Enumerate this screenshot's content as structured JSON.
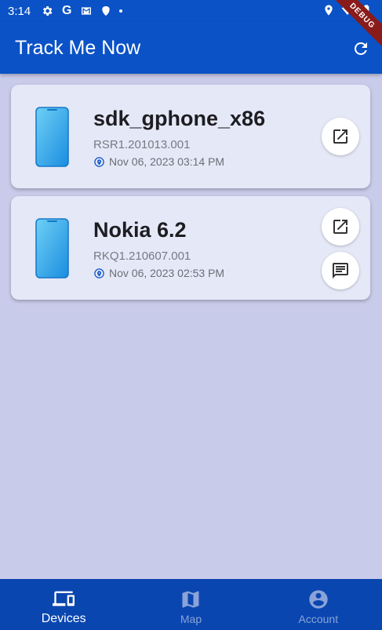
{
  "status_bar": {
    "time": "3:14",
    "left_icons": [
      "gear-icon",
      "google-icon",
      "gmail-icon",
      "shield-icon",
      "dot-icon"
    ],
    "right_icons": [
      "location-icon",
      "wifi-icon",
      "battery-icon"
    ],
    "google_letter": "G"
  },
  "debug_banner": "DEBUG",
  "app_bar": {
    "title": "Track Me Now",
    "refresh_icon": "refresh-icon"
  },
  "devices": [
    {
      "name": "sdk_gphone_x86",
      "build": "RSR1.201013.001",
      "last_seen": "Nov 06, 2023 03:14 PM",
      "actions": [
        "open-external-icon"
      ]
    },
    {
      "name": "Nokia 6.2",
      "build": "RKQ1.210607.001",
      "last_seen": "Nov 06, 2023 02:53 PM",
      "actions": [
        "open-external-icon",
        "message-icon"
      ]
    }
  ],
  "bottom_nav": {
    "items": [
      {
        "label": "Devices",
        "icon": "devices-icon",
        "active": true
      },
      {
        "label": "Map",
        "icon": "map-icon",
        "active": false
      },
      {
        "label": "Account",
        "icon": "account-circle-icon",
        "active": false
      }
    ]
  },
  "colors": {
    "primary": "#0a52c6",
    "nav_background": "#0a46b0",
    "page_background": "#c8cbe9",
    "card_background": "#e5e8f7",
    "debug_ribbon": "#8a1b1b"
  }
}
